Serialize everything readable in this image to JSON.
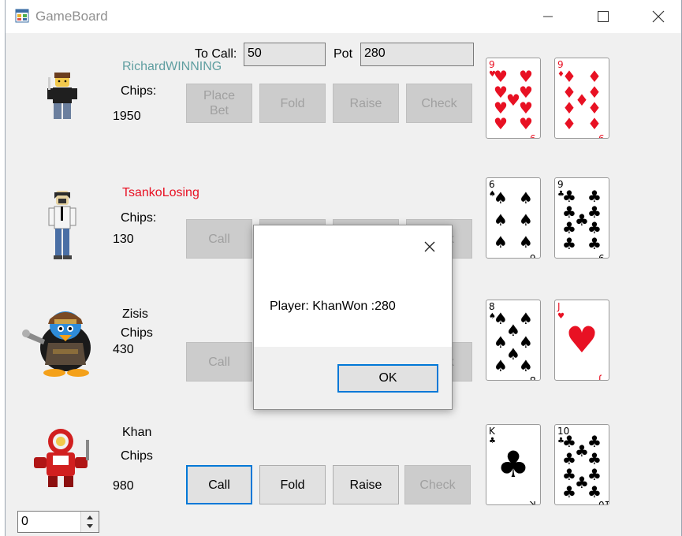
{
  "window": {
    "title": "GameBoard",
    "icons": {
      "app": "app-icon",
      "minimize": "minimize-icon",
      "maximize": "maximize-icon",
      "close": "close-icon"
    }
  },
  "header": {
    "to_call_label": "To Call:",
    "to_call_value": "50",
    "pot_label": "Pot",
    "pot_value": "280"
  },
  "players": [
    {
      "name": "RichardWINNING",
      "name_color": "#5f9ea0",
      "chips_label": "Chips:",
      "chips": "1950",
      "buttons": [
        "Place Bet",
        "Fold",
        "Raise",
        "Check"
      ],
      "cards": [
        {
          "rank": "9",
          "suit": "♥",
          "color": "#e81123"
        },
        {
          "rank": "9",
          "suit": "♦",
          "color": "#e81123"
        }
      ]
    },
    {
      "name": "TsankoLosing",
      "name_color": "#e81123",
      "chips_label": "Chips:",
      "chips": "130",
      "buttons": [
        "Call",
        "",
        "",
        "k"
      ],
      "cards": [
        {
          "rank": "6",
          "suit": "♠",
          "color": "#000000"
        },
        {
          "rank": "9",
          "suit": "♣",
          "color": "#000000"
        }
      ]
    },
    {
      "name": "Zisis",
      "name_color": "#000000",
      "chips_label": "Chips",
      "chips": "430",
      "buttons": [
        "Call",
        "k"
      ],
      "cards": [
        {
          "rank": "8",
          "suit": "♠",
          "color": "#000000"
        },
        {
          "rank": "J",
          "suit": "♥",
          "color": "#e81123"
        }
      ]
    },
    {
      "name": "Khan",
      "name_color": "#000000",
      "chips_label": "Chips",
      "chips": "980",
      "buttons": [
        "Call",
        "Fold",
        "Raise",
        "Check"
      ],
      "cards": [
        {
          "rank": "K",
          "suit": "♣",
          "color": "#000000"
        },
        {
          "rank": "10",
          "suit": "♣",
          "color": "#000000"
        }
      ]
    }
  ],
  "dialog": {
    "message": "Player: KhanWon :280",
    "ok_label": "OK"
  },
  "bet_input": {
    "value": "0"
  }
}
